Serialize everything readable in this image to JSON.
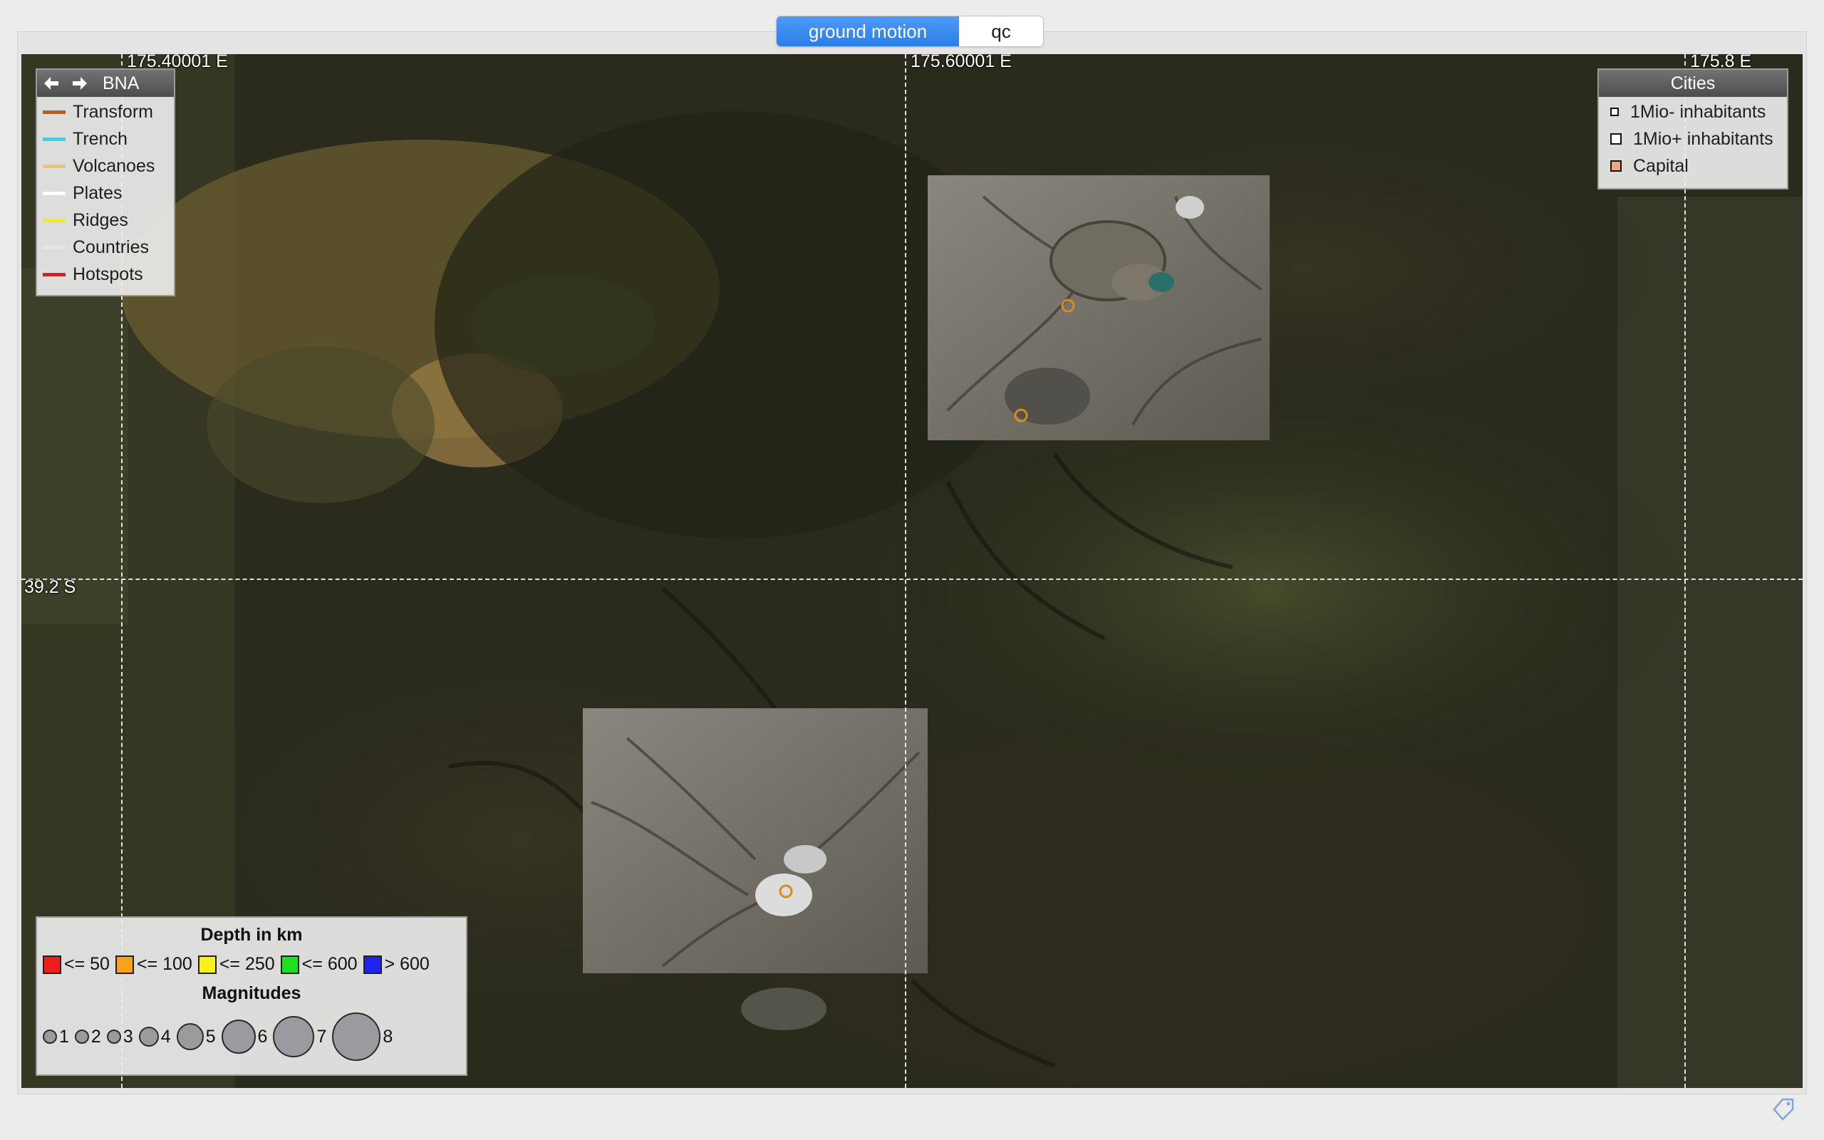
{
  "tabs": [
    {
      "label": "ground motion",
      "active": true
    },
    {
      "label": "qc",
      "active": false
    }
  ],
  "map": {
    "longitude_labels": [
      "175.40001 E",
      "175.60001 E",
      "175.8 E"
    ],
    "latitude_labels": [
      "39.2 S"
    ],
    "volcano_marker_color": "#d98a1e"
  },
  "layer_legend": {
    "title": "BNA",
    "items": [
      {
        "label": "Transform",
        "color": "#c2581a"
      },
      {
        "label": "Trench",
        "color": "#2fd8ee"
      },
      {
        "label": "Volcanoes",
        "color": "#f0c074"
      },
      {
        "label": "Plates",
        "color": "#ffffff"
      },
      {
        "label": "Ridges",
        "color": "#f3ec1a"
      },
      {
        "label": "Countries",
        "color": "#e6e6e6"
      },
      {
        "label": "Hotspots",
        "color": "#e41b1b"
      }
    ]
  },
  "cities_legend": {
    "title": "Cities",
    "items": [
      {
        "label": "1Mio- inhabitants",
        "fill": "#ffffff"
      },
      {
        "label": "1Mio+ inhabitants",
        "fill": "#ffffff"
      },
      {
        "label": "Capital",
        "fill": "#f2a57a"
      }
    ]
  },
  "depth_legend": {
    "title": "Depth in km",
    "items": [
      {
        "label": "<= 50",
        "color": "#ee1c1c"
      },
      {
        "label": "<= 100",
        "color": "#f7a21b"
      },
      {
        "label": "<= 250",
        "color": "#f7f21b"
      },
      {
        "label": "<= 600",
        "color": "#1fe01f"
      },
      {
        "label": "> 600",
        "color": "#1c24ee"
      }
    ]
  },
  "magnitude_legend": {
    "title": "Magnitudes",
    "items": [
      {
        "label": "1"
      },
      {
        "label": "2"
      },
      {
        "label": "3"
      },
      {
        "label": "4"
      },
      {
        "label": "5"
      },
      {
        "label": "6"
      },
      {
        "label": "7"
      },
      {
        "label": "8"
      }
    ]
  }
}
